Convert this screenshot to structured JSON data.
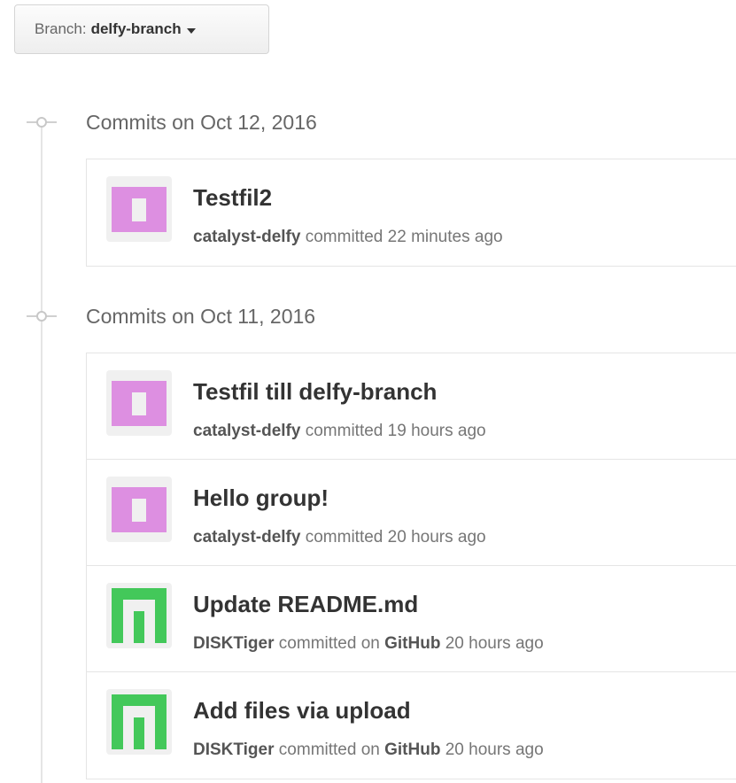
{
  "branch": {
    "prefix": "Branch:",
    "name": "delfy-branch"
  },
  "groups": [
    {
      "title": "Commits on Oct 12, 2016",
      "commits": [
        {
          "title": "Testfil2",
          "author": "catalyst-delfy",
          "committed_text": "committed",
          "via": "",
          "time": "22 minutes ago",
          "avatar_icon": "identicon-pink"
        }
      ]
    },
    {
      "title": "Commits on Oct 11, 2016",
      "commits": [
        {
          "title": "Testfil till delfy-branch",
          "author": "catalyst-delfy",
          "committed_text": "committed",
          "via": "",
          "time": "19 hours ago",
          "avatar_icon": "identicon-pink"
        },
        {
          "title": "Hello group!",
          "author": "catalyst-delfy",
          "committed_text": "committed",
          "via": "",
          "time": "20 hours ago",
          "avatar_icon": "identicon-pink"
        },
        {
          "title": "Update README.md",
          "author": "DISKTiger",
          "committed_text": "committed on",
          "via": "GitHub",
          "time": "20 hours ago",
          "avatar_icon": "identicon-green"
        },
        {
          "title": "Add files via upload",
          "author": "DISKTiger",
          "committed_text": "committed on",
          "via": "GitHub",
          "time": "20 hours ago",
          "avatar_icon": "identicon-green"
        }
      ]
    }
  ],
  "colors": {
    "identicon_pink": "#dd8fe1",
    "identicon_green": "#43c85a"
  }
}
